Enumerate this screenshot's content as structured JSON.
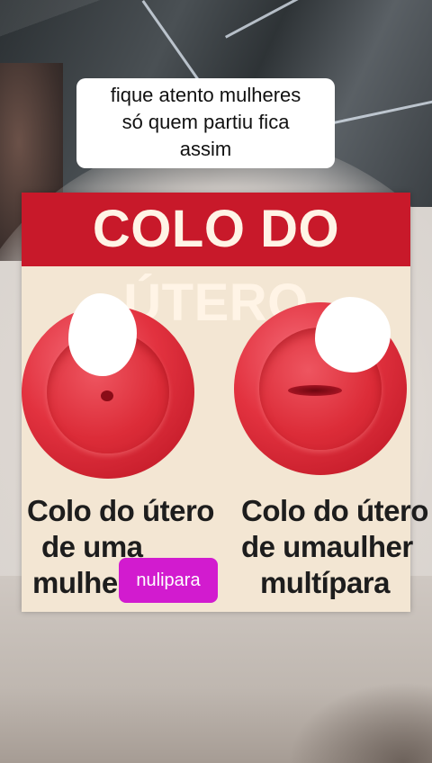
{
  "caption": {
    "lines": [
      "fique atento mulheres",
      "só quem partiu fica",
      "assim"
    ]
  },
  "poster": {
    "title": "COLO DO ÚTERO",
    "left": {
      "lines": [
        "Colo do útero",
        "de uma",
        "mulher"
      ],
      "tag": "nulipara"
    },
    "right": {
      "lines": [
        "Colo do útero",
        "de umaulher",
        "multípara"
      ]
    }
  },
  "colors": {
    "banner": "#c8192a",
    "poster_bg": "#f3e6d3",
    "tag": "#d21bcf"
  }
}
